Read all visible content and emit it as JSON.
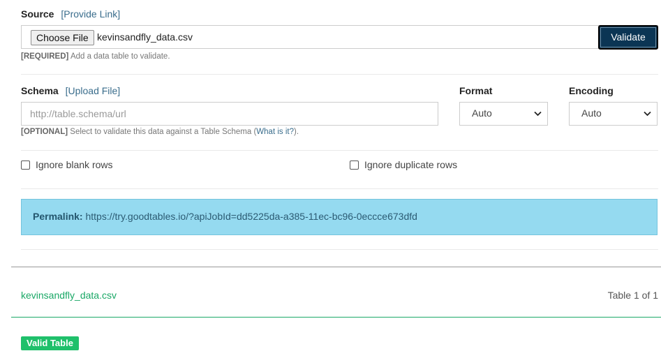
{
  "source": {
    "label": "Source",
    "link": "[Provide Link]",
    "choose_button": "Choose File",
    "file_name": "kevinsandfly_data.csv",
    "validate_button": "Validate",
    "help_tag": "[REQUIRED]",
    "help_text": "Add a data table to validate."
  },
  "schema": {
    "label": "Schema",
    "link": "[Upload File]",
    "placeholder": "http://table.schema/url",
    "help_tag": "[OPTIONAL]",
    "help_text": "Select to validate this data against a Table Schema (",
    "help_link": "What is it?",
    "help_end": ")."
  },
  "format": {
    "label": "Format",
    "selected": "Auto"
  },
  "encoding": {
    "label": "Encoding",
    "selected": "Auto"
  },
  "options": {
    "ignore_blank": "Ignore blank rows",
    "ignore_duplicate": "Ignore duplicate rows"
  },
  "permalink": {
    "label": "Permalink:",
    "url": "https://try.goodtables.io/?apiJobId=dd5225da-a385-11ec-bc96-0eccce673dfd"
  },
  "result": {
    "file_name": "kevinsandfly_data.csv",
    "table_count": "Table 1 of 1",
    "status_badge": "Valid Table"
  },
  "colors": {
    "validate_bg": "#0b3554",
    "permalink_bg": "#95daf0",
    "valid_green": "#1fc06b",
    "file_green": "#1aa866"
  },
  "icons": {
    "select_arrow": "chevron-down-icon"
  }
}
